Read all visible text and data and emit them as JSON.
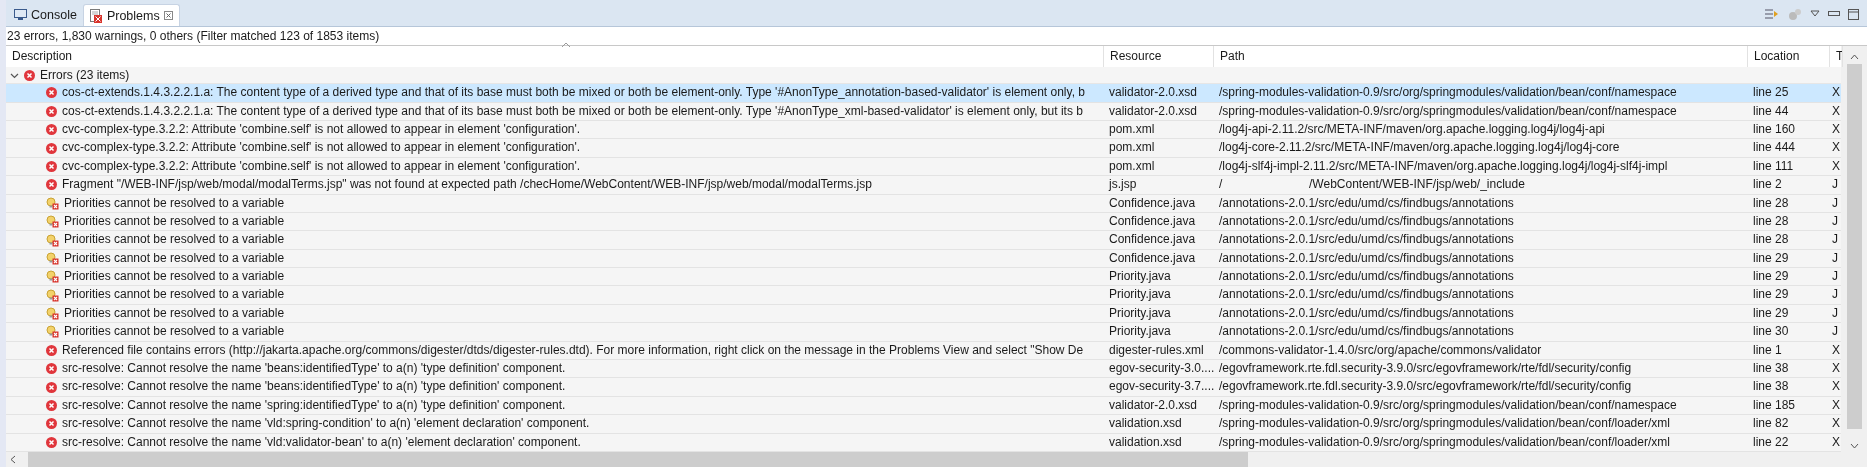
{
  "tabs": [
    {
      "label": "Console",
      "kind": "console",
      "selected": false,
      "closable": false
    },
    {
      "label": "Problems",
      "kind": "problems",
      "selected": true,
      "closable": true
    }
  ],
  "summary": "23 errors, 1,830 warnings, 0 others (Filter matched 123 of 1853 items)",
  "table": {
    "columns": [
      "Description",
      "Resource",
      "Path",
      "Location",
      "T"
    ],
    "groups": [
      {
        "label": "Errors (23 items)",
        "expanded": true,
        "rows": [
          {
            "kind": "error",
            "selected": true,
            "description": "cos-ct-extends.1.4.3.2.2.1.a: The content type of a derived type and that of its base must both be mixed or both be element-only. Type '#AnonType_annotation-based-validator' is element only, b",
            "resource": "validator-2.0.xsd",
            "path": "/spring-modules-validation-0.9/src/org/springmodules/validation/bean/conf/namespace",
            "location": "line 25",
            "type": "X"
          },
          {
            "kind": "error",
            "selected": false,
            "description": "cos-ct-extends.1.4.3.2.2.1.a: The content type of a derived type and that of its base must both be mixed or both be element-only. Type '#AnonType_xml-based-validator' is element only, but its b",
            "resource": "validator-2.0.xsd",
            "path": "/spring-modules-validation-0.9/src/org/springmodules/validation/bean/conf/namespace",
            "location": "line 44",
            "type": "X"
          },
          {
            "kind": "error",
            "selected": false,
            "description": "cvc-complex-type.3.2.2: Attribute 'combine.self' is not allowed to appear in element 'configuration'.",
            "resource": "pom.xml",
            "path": "/log4j-api-2.11.2/src/META-INF/maven/org.apache.logging.log4j/log4j-api",
            "location": "line 160",
            "type": "X"
          },
          {
            "kind": "error",
            "selected": false,
            "description": "cvc-complex-type.3.2.2: Attribute 'combine.self' is not allowed to appear in element 'configuration'.",
            "resource": "pom.xml",
            "path": "/log4j-core-2.11.2/src/META-INF/maven/org.apache.logging.log4j/log4j-core",
            "location": "line 444",
            "type": "X"
          },
          {
            "kind": "error",
            "selected": false,
            "description": "cvc-complex-type.3.2.2: Attribute 'combine.self' is not allowed to appear in element 'configuration'.",
            "resource": "pom.xml",
            "path": "/log4j-slf4j-impl-2.11.2/src/META-INF/maven/org.apache.logging.log4j/log4j-slf4j-impl",
            "location": "line 111",
            "type": "X"
          },
          {
            "kind": "error",
            "selected": false,
            "description": "Fragment \"/WEB-INF/jsp/web/modal/modalTerms.jsp\" was not found at expected path /checHome/WebContent/WEB-INF/jsp/web/modal/modalTerms.jsp",
            "resource": "js.jsp",
            "path": "/                          /WebContent/WEB-INF/jsp/web/_include",
            "location": "line 2",
            "type": "J"
          },
          {
            "kind": "quickfix",
            "selected": false,
            "description": "Priorities cannot be resolved to a variable",
            "resource": "Confidence.java",
            "path": "/annotations-2.0.1/src/edu/umd/cs/findbugs/annotations",
            "location": "line 28",
            "type": "J"
          },
          {
            "kind": "quickfix",
            "selected": false,
            "description": "Priorities cannot be resolved to a variable",
            "resource": "Confidence.java",
            "path": "/annotations-2.0.1/src/edu/umd/cs/findbugs/annotations",
            "location": "line 28",
            "type": "J"
          },
          {
            "kind": "quickfix",
            "selected": false,
            "description": "Priorities cannot be resolved to a variable",
            "resource": "Confidence.java",
            "path": "/annotations-2.0.1/src/edu/umd/cs/findbugs/annotations",
            "location": "line 28",
            "type": "J"
          },
          {
            "kind": "quickfix",
            "selected": false,
            "description": "Priorities cannot be resolved to a variable",
            "resource": "Confidence.java",
            "path": "/annotations-2.0.1/src/edu/umd/cs/findbugs/annotations",
            "location": "line 29",
            "type": "J"
          },
          {
            "kind": "quickfix",
            "selected": false,
            "description": "Priorities cannot be resolved to a variable",
            "resource": "Priority.java",
            "path": "/annotations-2.0.1/src/edu/umd/cs/findbugs/annotations",
            "location": "line 29",
            "type": "J"
          },
          {
            "kind": "quickfix",
            "selected": false,
            "description": "Priorities cannot be resolved to a variable",
            "resource": "Priority.java",
            "path": "/annotations-2.0.1/src/edu/umd/cs/findbugs/annotations",
            "location": "line 29",
            "type": "J"
          },
          {
            "kind": "quickfix",
            "selected": false,
            "description": "Priorities cannot be resolved to a variable",
            "resource": "Priority.java",
            "path": "/annotations-2.0.1/src/edu/umd/cs/findbugs/annotations",
            "location": "line 29",
            "type": "J"
          },
          {
            "kind": "quickfix",
            "selected": false,
            "description": "Priorities cannot be resolved to a variable",
            "resource": "Priority.java",
            "path": "/annotations-2.0.1/src/edu/umd/cs/findbugs/annotations",
            "location": "line 30",
            "type": "J"
          },
          {
            "kind": "error",
            "selected": false,
            "description": "Referenced file contains errors (http://jakarta.apache.org/commons/digester/dtds/digester-rules.dtd).  For more information, right click on the message in the Problems View and select \"Show De",
            "resource": "digester-rules.xml",
            "path": "/commons-validator-1.4.0/src/org/apache/commons/validator",
            "location": "line 1",
            "type": "X"
          },
          {
            "kind": "error",
            "selected": false,
            "description": "src-resolve: Cannot resolve the name 'beans:identifiedType' to a(n) 'type definition' component.",
            "resource": "egov-security-3.0....",
            "path": "/egovframework.rte.fdl.security-3.9.0/src/egovframework/rte/fdl/security/config",
            "location": "line 38",
            "type": "X"
          },
          {
            "kind": "error",
            "selected": false,
            "description": "src-resolve: Cannot resolve the name 'beans:identifiedType' to a(n) 'type definition' component.",
            "resource": "egov-security-3.7....",
            "path": "/egovframework.rte.fdl.security-3.9.0/src/egovframework/rte/fdl/security/config",
            "location": "line 38",
            "type": "X"
          },
          {
            "kind": "error",
            "selected": false,
            "description": "src-resolve: Cannot resolve the name 'spring:identifiedType' to a(n) 'type definition' component.",
            "resource": "validator-2.0.xsd",
            "path": "/spring-modules-validation-0.9/src/org/springmodules/validation/bean/conf/namespace",
            "location": "line 185",
            "type": "X"
          },
          {
            "kind": "error",
            "selected": false,
            "description": "src-resolve: Cannot resolve the name 'vld:spring-condition' to a(n) 'element declaration' component.",
            "resource": "validation.xsd",
            "path": "/spring-modules-validation-0.9/src/org/springmodules/validation/bean/conf/loader/xml",
            "location": "line 82",
            "type": "X"
          },
          {
            "kind": "error",
            "selected": false,
            "description": "src-resolve: Cannot resolve the name 'vld:validator-bean' to a(n) 'element declaration' component.",
            "resource": "validation.xsd",
            "path": "/spring-modules-validation-0.9/src/org/springmodules/validation/bean/conf/loader/xml",
            "location": "line 22",
            "type": "X"
          }
        ]
      }
    ]
  }
}
